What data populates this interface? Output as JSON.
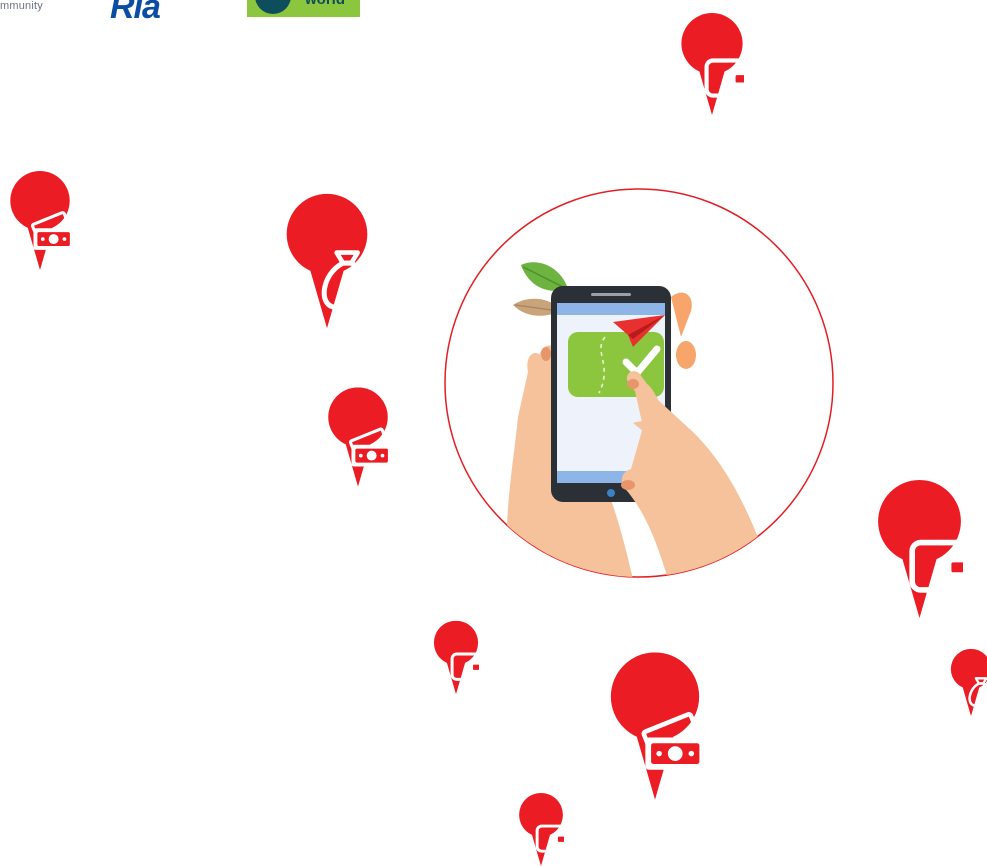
{
  "logos": {
    "community_text": "mmunity",
    "ria_text": "Ria",
    "world_text": "world"
  },
  "colors": {
    "pin_red": "#ec1c24",
    "circle_outline": "#e31e24",
    "phone_body": "#2b2f36",
    "screen_bar": "#8db5e8",
    "check_card": "#8cc63f",
    "skin": "#f5c29b",
    "nail": "#e8956b"
  },
  "pins": [
    {
      "icon": "wallet-icon"
    },
    {
      "icon": "money-bills-icon"
    },
    {
      "icon": "money-bag-icon"
    },
    {
      "icon": "money-bills-icon"
    },
    {
      "icon": "wallet-icon"
    },
    {
      "icon": "wallet-icon"
    },
    {
      "icon": "money-bills-icon"
    },
    {
      "icon": "money-bag-icon"
    },
    {
      "icon": "wallet-icon"
    }
  ],
  "hero": {
    "subject": "hands-holding-phone-with-payment-confirmation",
    "icons": [
      "paper-plane-icon",
      "checkmark-icon",
      "leaf-icon"
    ]
  }
}
